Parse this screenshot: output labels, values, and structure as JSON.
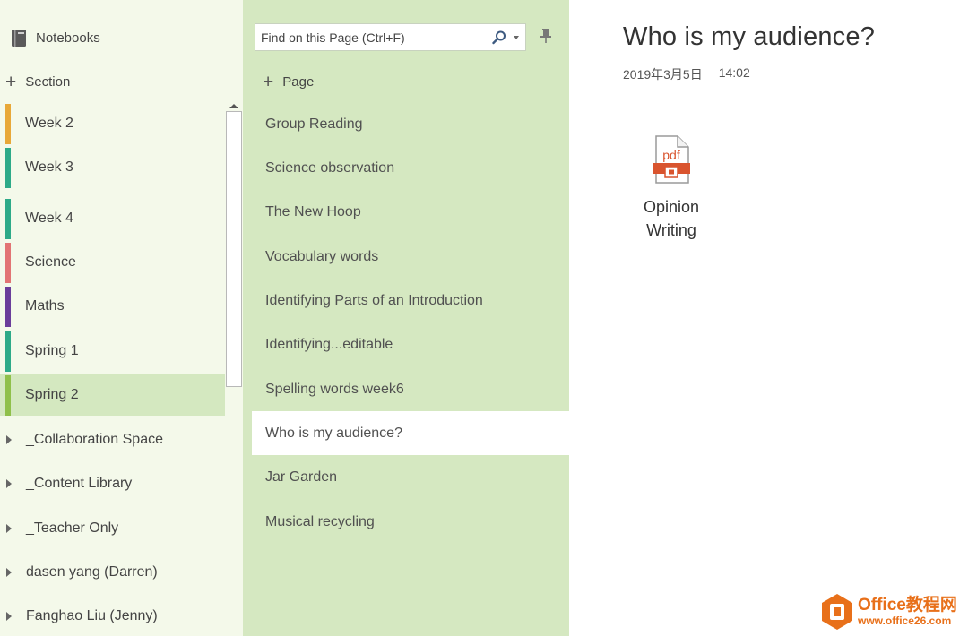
{
  "sections_pane": {
    "notebooks_label": "Notebooks",
    "add_section_label": "Section",
    "sections": [
      {
        "label": "Week 2",
        "color": "#e8a838"
      },
      {
        "label": "Week 3",
        "color": "#2daa88"
      },
      {
        "label": "Week 4",
        "color": "#2daa88"
      },
      {
        "label": "Science",
        "color": "#e27474"
      },
      {
        "label": "Maths",
        "color": "#6a3d9a"
      },
      {
        "label": "Spring 1",
        "color": "#2daa88"
      },
      {
        "label": "Spring 2",
        "color": "#8fc04a"
      }
    ],
    "groups": [
      "_Collaboration Space",
      "_Content Library",
      "_Teacher Only",
      "dasen yang (Darren)",
      "Fanghao Liu (Jenny)"
    ]
  },
  "pages_pane": {
    "search_placeholder": "Find on this Page (Ctrl+F)",
    "add_page_label": "Page",
    "pages": [
      "Group Reading",
      "Science observation",
      "The New Hoop",
      "Vocabulary words",
      "Identifying Parts of an Introduction",
      "Identifying...editable",
      "Spelling words week6",
      "Who is my audience?",
      "Jar Garden",
      "Musical recycling"
    ],
    "selected_page": "Who is my audience?"
  },
  "content": {
    "title": "Who is my audience?",
    "date": "2019年3月5日",
    "time": "14:02",
    "attachment": {
      "icon_text": "pdf",
      "label_line1": "Opinion",
      "label_line2": "Writing"
    }
  },
  "watermark": {
    "title": "Office教程网",
    "url": "www.office26.com"
  },
  "colors": {
    "sections_bg": "#f4f9ea",
    "pages_bg": "#d5e8c1",
    "selected_section_bg": "#d4e8c0",
    "pdf_red": "#d9542e",
    "watermark_orange": "#e8701a"
  }
}
